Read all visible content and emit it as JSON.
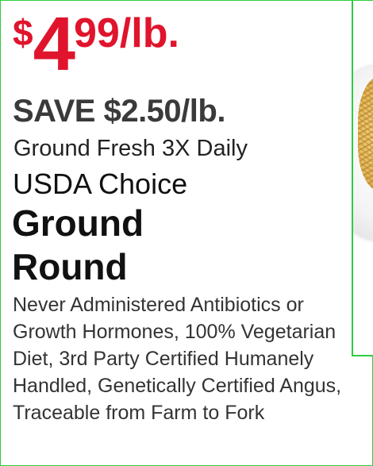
{
  "ad": {
    "price": {
      "currency": "$",
      "dollars": "4",
      "cents_unit": "99/lb."
    },
    "savings": "SAVE $2.50/lb.",
    "tagline": "Ground Fresh 3X Daily",
    "grade": "USDA Choice",
    "product_name_line1": "Ground",
    "product_name_line2": "Round",
    "description": "Never Administered Antibiotics or Growth Hormones, 100% Vegetarian Diet, 3rd Party Certified Humanely Handled, Genetically Certified Angus, Traceable from Farm to Fork"
  },
  "colors": {
    "price_red": "#e0142c",
    "frame_green": "#2ecc40"
  }
}
